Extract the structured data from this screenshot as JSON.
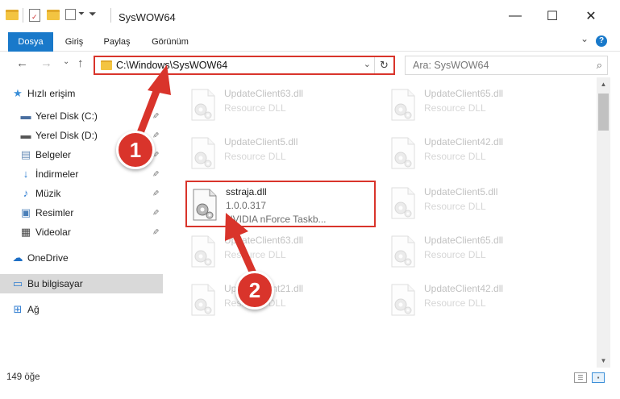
{
  "window": {
    "title": "SysWOW64",
    "minimize_glyph": "—",
    "maximize_glyph": "☐",
    "close_glyph": "✕"
  },
  "ribbon": {
    "tabs": [
      {
        "label": "Dosya"
      },
      {
        "label": "Giriş"
      },
      {
        "label": "Paylaş"
      },
      {
        "label": "Görünüm"
      }
    ],
    "expand_glyph": "⌄",
    "help_glyph": "?"
  },
  "address": {
    "path": "C:\\Windows\\SysWOW64",
    "dropdown_glyph": "⌄",
    "refresh_glyph": "↻",
    "search_placeholder": "Ara: SysWOW64",
    "back_glyph": "←",
    "forward_glyph": "→",
    "recent_glyph": "⌄",
    "up_glyph": "↑"
  },
  "nav": {
    "items": [
      {
        "label": "Hızlı erişim",
        "icon": "star-icon",
        "glyph": "★",
        "color": "#3b8fd8"
      },
      {
        "label": "Yerel Disk (C:)",
        "icon": "drive-icon",
        "glyph": "▬",
        "color": "#4a6fa0",
        "pinned": true
      },
      {
        "label": "Yerel Disk (D:)",
        "icon": "drive-icon",
        "glyph": "▬",
        "color": "#555555",
        "pinned": true
      },
      {
        "label": "Belgeler",
        "icon": "documents-icon",
        "glyph": "▤",
        "color": "#6b8fb8",
        "pinned": true
      },
      {
        "label": "İndirmeler",
        "icon": "download-icon",
        "glyph": "↓",
        "color": "#2d7bd0",
        "pinned": true
      },
      {
        "label": "Müzik",
        "icon": "music-icon",
        "glyph": "♪",
        "color": "#2d7bd0",
        "pinned": true
      },
      {
        "label": "Resimler",
        "icon": "pictures-icon",
        "glyph": "▣",
        "color": "#4a7fb8",
        "pinned": true
      },
      {
        "label": "Videolar",
        "icon": "videos-icon",
        "glyph": "▦",
        "color": "#444444",
        "pinned": true
      },
      {
        "label": "OneDrive",
        "icon": "cloud-icon",
        "glyph": "☁",
        "color": "#1e6fc5"
      },
      {
        "label": "Bu bilgisayar",
        "icon": "computer-icon",
        "glyph": "▭",
        "color": "#2d7bd0"
      },
      {
        "label": "Ağ",
        "icon": "network-icon",
        "glyph": "⊞",
        "color": "#2d7bd0"
      }
    ],
    "pin_glyph": "📌"
  },
  "files": [
    {
      "name": "UpdateClient63.dll",
      "sub": "Resource DLL",
      "faded": true
    },
    {
      "name": "UpdateClient65.dll",
      "sub": "Resource DLL",
      "faded": true
    },
    {
      "name": "UpdateClient5.dll",
      "sub": "Resource DLL",
      "faded": true
    },
    {
      "name": "UpdateClient42.dll",
      "sub": "Resource DLL",
      "faded": true
    },
    {
      "name": "sstraja.dll",
      "sub": "1.0.0.317",
      "sub2": "NVIDIA nForce Taskb...",
      "faded": false
    },
    {
      "name": "UpdateClient5.dll",
      "sub": "Resource DLL",
      "faded": true
    },
    {
      "name": "UpdateClient63.dll",
      "sub": "Resource DLL",
      "faded": true
    },
    {
      "name": "UpdateClient65.dll",
      "sub": "Resource DLL",
      "faded": true
    },
    {
      "name": "UpdateClient21.dll",
      "sub": "Resource DLL",
      "faded": true
    },
    {
      "name": "UpdateClient42.dll",
      "sub": "Resource DLL",
      "faded": true
    }
  ],
  "status": {
    "count_text": "149 öğe"
  },
  "annotations": {
    "badge1": "1",
    "badge2": "2"
  },
  "colors": {
    "accent": "#1979ca",
    "highlight_red": "#d9342b"
  }
}
